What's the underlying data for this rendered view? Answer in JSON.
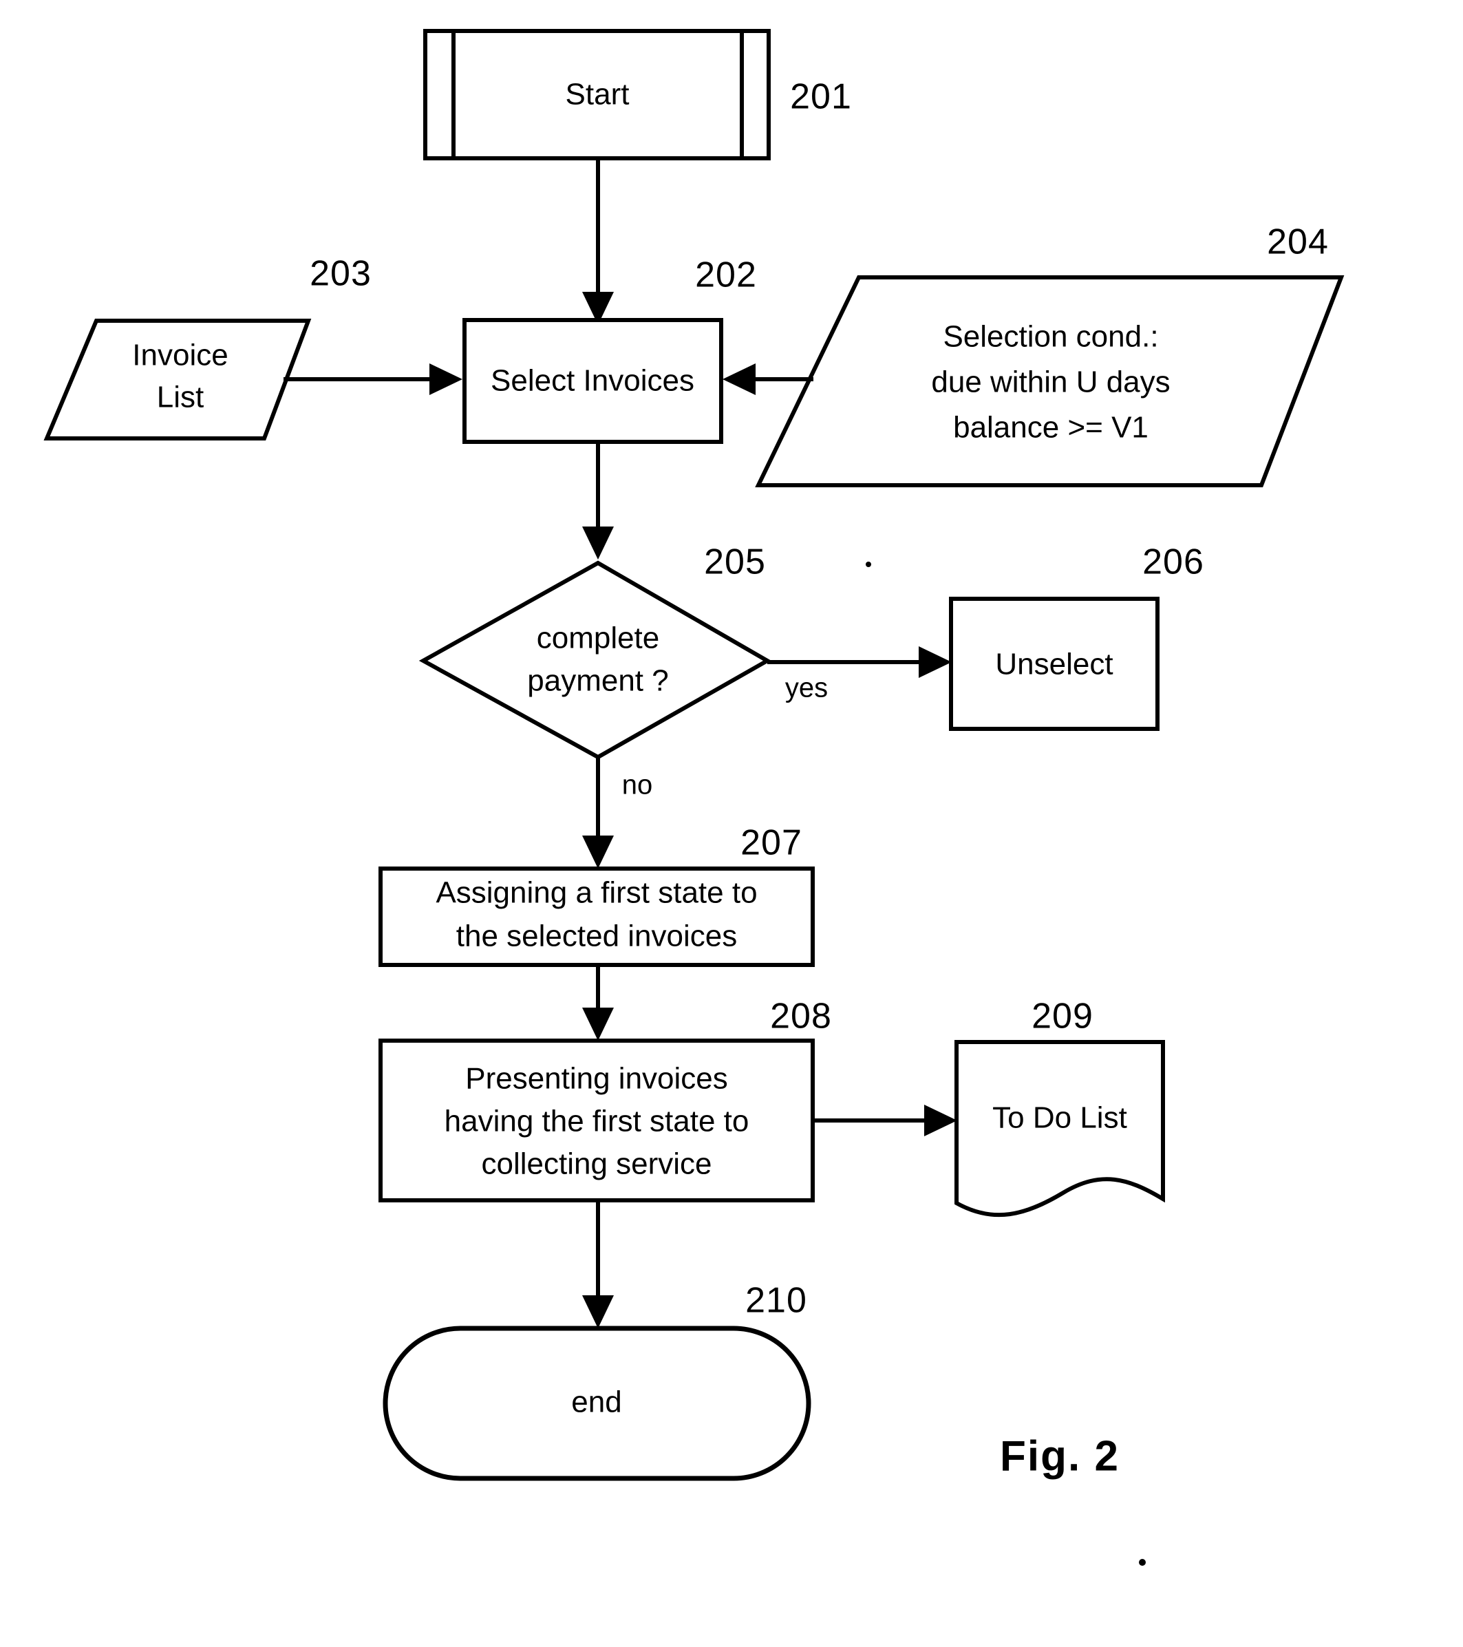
{
  "figure": {
    "caption": "Fig.  2",
    "title": "Flowchart for selecting invoices and presenting them to a collecting service"
  },
  "nodes": [
    {
      "id": "201",
      "ref": "201",
      "shape": "predefined-process",
      "label": "Start",
      "name": "start-node"
    },
    {
      "id": "203",
      "ref": "203",
      "shape": "parallelogram",
      "label_lines": [
        "Invoice",
        "List"
      ],
      "name": "invoice-list-node"
    },
    {
      "id": "202",
      "ref": "202",
      "shape": "rectangle",
      "label": "Select Invoices",
      "name": "select-invoices-node"
    },
    {
      "id": "204",
      "ref": "204",
      "shape": "parallelogram",
      "label_lines": [
        "Selection cond.:",
        "due within U days",
        "balance >= V1"
      ],
      "name": "selection-condition-node"
    },
    {
      "id": "205",
      "ref": "205",
      "shape": "diamond",
      "label_lines": [
        "complete",
        "payment  ?"
      ],
      "name": "complete-payment-decision"
    },
    {
      "id": "206",
      "ref": "206",
      "shape": "rectangle",
      "label": "Unselect",
      "name": "unselect-node"
    },
    {
      "id": "207",
      "ref": "207",
      "shape": "rectangle",
      "label_lines": [
        "Assigning a first state to",
        "the selected invoices"
      ],
      "name": "assign-first-state-node"
    },
    {
      "id": "208",
      "ref": "208",
      "shape": "rectangle",
      "label_lines": [
        "Presenting invoices",
        "having the first state to",
        "collecting service"
      ],
      "name": "presenting-invoices-node"
    },
    {
      "id": "209",
      "ref": "209",
      "shape": "document",
      "label": "To Do List",
      "name": "to-do-list-node"
    },
    {
      "id": "210",
      "ref": "210",
      "shape": "stadium",
      "label": "end",
      "name": "end-node"
    }
  ],
  "edges": [
    {
      "from": "201",
      "to": "202",
      "label": "",
      "name": "edge-start-to-select"
    },
    {
      "from": "203",
      "to": "202",
      "label": "",
      "name": "edge-invoicelist-to-select"
    },
    {
      "from": "204",
      "to": "202",
      "label": "",
      "name": "edge-condition-to-select"
    },
    {
      "from": "202",
      "to": "205",
      "label": "",
      "name": "edge-select-to-decision"
    },
    {
      "from": "205",
      "to": "206",
      "label": "yes",
      "name": "edge-decision-yes-to-unselect"
    },
    {
      "from": "205",
      "to": "207",
      "label": "no",
      "name": "edge-decision-no-to-assign"
    },
    {
      "from": "207",
      "to": "208",
      "label": "",
      "name": "edge-assign-to-present"
    },
    {
      "from": "208",
      "to": "209",
      "label": "",
      "name": "edge-present-to-todolist"
    },
    {
      "from": "208",
      "to": "210",
      "label": "",
      "name": "edge-present-to-end"
    }
  ],
  "labels": {
    "ref_201": "201",
    "ref_202": "202",
    "ref_203": "203",
    "ref_204": "204",
    "ref_205": "205",
    "ref_206": "206",
    "ref_207": "207",
    "ref_208": "208",
    "ref_209": "209",
    "ref_210": "210",
    "start": "Start",
    "invoice_list_l1": "Invoice",
    "invoice_list_l2": "List",
    "select_invoices": "Select Invoices",
    "selection_cond_l1": "Selection cond.:",
    "selection_cond_l2": "due within U days",
    "selection_cond_l3": "balance >= V1",
    "decision_l1": "complete",
    "decision_l2": "payment  ?",
    "yes": "yes",
    "no": "no",
    "unselect": "Unselect",
    "assign_l1": "Assigning a first state to",
    "assign_l2": "the selected invoices",
    "present_l1": "Presenting invoices",
    "present_l2": "having the first state to",
    "present_l3": "collecting service",
    "to_do_list": "To Do List",
    "end": "end",
    "fig_caption": "Fig.  2"
  },
  "colors": {
    "stroke": "#000000",
    "fill": "#ffffff",
    "background": "#ffffff"
  }
}
